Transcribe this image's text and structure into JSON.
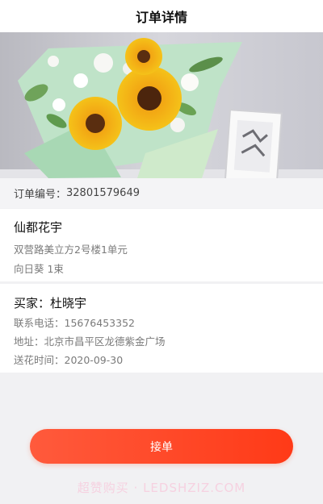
{
  "header": {
    "title": "订单详情"
  },
  "hero": {
    "image": "sunflower-bouquet"
  },
  "order": {
    "label": "订单编号：",
    "number": "32801579649"
  },
  "shop": {
    "name": "仙都花宇",
    "address": "双营路美立方2号楼1单元",
    "product": "向日葵 1束"
  },
  "buyer": {
    "title": "买家：杜晓宇",
    "phone": "联系电话：15676453352",
    "address": "地址：北京市昌平区龙德紫金广场",
    "delivery_time": "送花时间：2020-09-30"
  },
  "actions": {
    "accept_label": "接单"
  },
  "watermark": {
    "text": "超赞购买 · LEDSHZIZ.COM"
  },
  "colors": {
    "accent": "#ff4a24",
    "background": "#f1f1f3"
  }
}
